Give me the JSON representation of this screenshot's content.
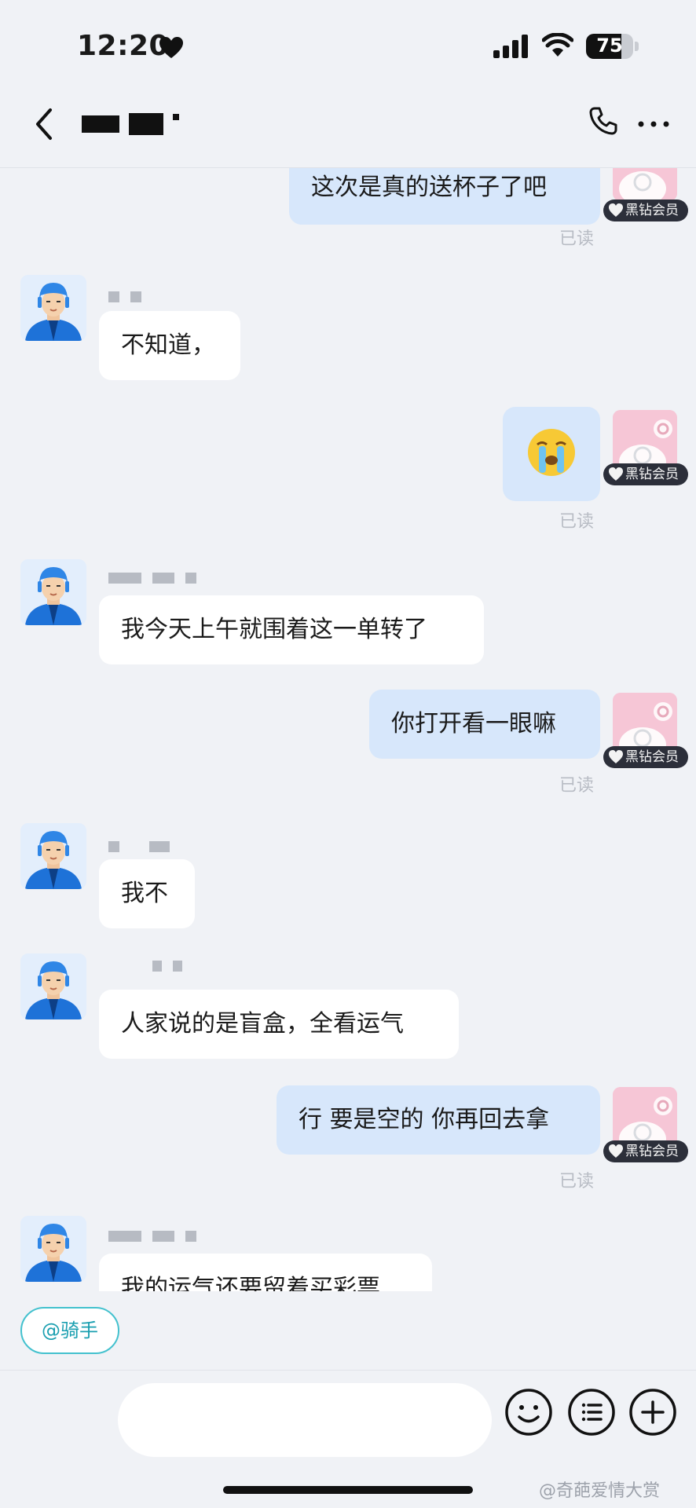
{
  "status_bar": {
    "time": "12:20",
    "battery_level": "75",
    "battery_fraction": 0.75
  },
  "header": {
    "icons": [
      "chevron-left-icon",
      "phone-icon",
      "more-icon"
    ]
  },
  "messages": [
    {
      "side": "out",
      "text": "这次是真的送杯子了吧",
      "status": "已读",
      "badge": "黑钻会员"
    },
    {
      "side": "in",
      "text": "不知道，"
    },
    {
      "side": "out",
      "emoji": "crying-face-icon",
      "status": "已读",
      "badge": "黑钻会员"
    },
    {
      "side": "in",
      "text": "我今天上午就围着这一单转了"
    },
    {
      "side": "out",
      "text": "你打开看一眼嘛",
      "status": "已读",
      "badge": "黑钻会员"
    },
    {
      "side": "in",
      "text": "我不"
    },
    {
      "side": "in",
      "text": "人家说的是盲盒，全看运气"
    },
    {
      "side": "out",
      "text": "行 要是空的 你再回去拿",
      "status": "已读",
      "badge": "黑钻会员"
    },
    {
      "side": "in",
      "text": "我的运气还要留着买彩票"
    }
  ],
  "mention_chip": {
    "label": "@骑手"
  },
  "input_bar": {
    "icons": [
      "emoji-face-icon",
      "list-menu-icon",
      "plus-icon"
    ]
  },
  "watermark": "@奇葩爱情大赏",
  "colors": {
    "background": "#f0f2f6",
    "outgoing_bubble": "#d7e7fb",
    "incoming_bubble": "#ffffff",
    "chip_border": "#43c1ce",
    "vip_badge": "#2c2f3a"
  }
}
